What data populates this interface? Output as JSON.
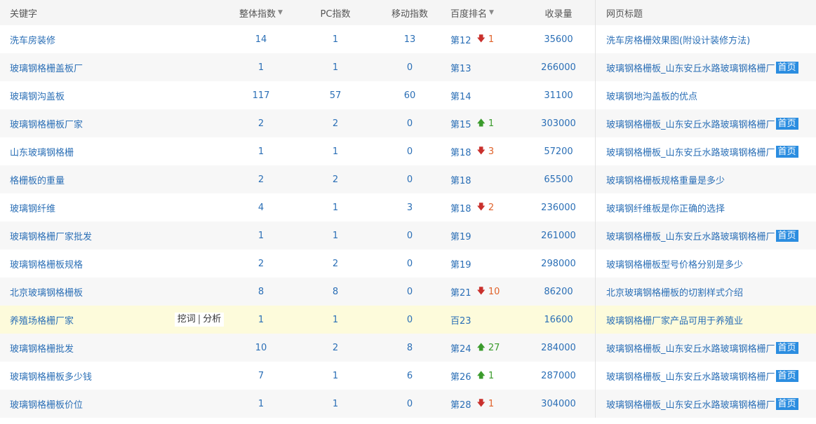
{
  "header": {
    "keyword": "关键字",
    "total_index": "整体指数",
    "pc_index": "PC指数",
    "mobile_index": "移动指数",
    "baidu_rank": "百度排名",
    "indexed_count": "收录量",
    "page_title": "网页标题"
  },
  "tools": {
    "dig": "挖词",
    "separator": "|",
    "analyze": "分析"
  },
  "rows": [
    {
      "keyword": "洗车房装修",
      "total": "14",
      "pc": "1",
      "mobile": "13",
      "rank": "第12",
      "change_dir": "down",
      "change": "1",
      "indexed": "35600",
      "title": "洗车房格栅效果图(附设计装修方法)",
      "badge": ""
    },
    {
      "keyword": "玻璃钢格栅盖板厂",
      "total": "1",
      "pc": "1",
      "mobile": "0",
      "rank": "第13",
      "change_dir": "",
      "change": "",
      "indexed": "266000",
      "title": "玻璃钢格栅板_山东安丘水路玻璃钢格栅厂",
      "badge": "首页"
    },
    {
      "keyword": "玻璃钢沟盖板",
      "total": "117",
      "pc": "57",
      "mobile": "60",
      "rank": "第14",
      "change_dir": "",
      "change": "",
      "indexed": "31100",
      "title": "玻璃钢地沟盖板的优点",
      "badge": ""
    },
    {
      "keyword": "玻璃钢格栅板厂家",
      "total": "2",
      "pc": "2",
      "mobile": "0",
      "rank": "第15",
      "change_dir": "up",
      "change": "1",
      "indexed": "303000",
      "title": "玻璃钢格栅板_山东安丘水路玻璃钢格栅厂",
      "badge": "首页"
    },
    {
      "keyword": "山东玻璃钢格栅",
      "total": "1",
      "pc": "1",
      "mobile": "0",
      "rank": "第18",
      "change_dir": "down",
      "change": "3",
      "indexed": "57200",
      "title": "玻璃钢格栅板_山东安丘水路玻璃钢格栅厂",
      "badge": "首页"
    },
    {
      "keyword": "格栅板的重量",
      "total": "2",
      "pc": "2",
      "mobile": "0",
      "rank": "第18",
      "change_dir": "",
      "change": "",
      "indexed": "65500",
      "title": "玻璃钢格栅板规格重量是多少",
      "badge": ""
    },
    {
      "keyword": "玻璃钢纤维",
      "total": "4",
      "pc": "1",
      "mobile": "3",
      "rank": "第18",
      "change_dir": "down",
      "change": "2",
      "indexed": "236000",
      "title": "玻璃钢纤维板是你正确的选择",
      "badge": ""
    },
    {
      "keyword": "玻璃钢格栅厂家批发",
      "total": "1",
      "pc": "1",
      "mobile": "0",
      "rank": "第19",
      "change_dir": "",
      "change": "",
      "indexed": "261000",
      "title": "玻璃钢格栅板_山东安丘水路玻璃钢格栅厂",
      "badge": "首页"
    },
    {
      "keyword": "玻璃钢格栅板规格",
      "total": "2",
      "pc": "2",
      "mobile": "0",
      "rank": "第19",
      "change_dir": "",
      "change": "",
      "indexed": "298000",
      "title": "玻璃钢格栅板型号价格分别是多少",
      "badge": ""
    },
    {
      "keyword": "北京玻璃钢格栅板",
      "total": "8",
      "pc": "8",
      "mobile": "0",
      "rank": "第21",
      "change_dir": "down",
      "change": "10",
      "indexed": "86200",
      "title": "北京玻璃钢格栅板的切割样式介绍",
      "badge": ""
    },
    {
      "keyword": "养殖场格栅厂家",
      "total": "1",
      "pc": "1",
      "mobile": "0",
      "rank": "百23",
      "change_dir": "",
      "change": "",
      "indexed": "16600",
      "title": "玻璃钢格栅厂家产品可用于养殖业",
      "badge": "",
      "highlight": true
    },
    {
      "keyword": "玻璃钢格栅批发",
      "total": "10",
      "pc": "2",
      "mobile": "8",
      "rank": "第24",
      "change_dir": "up",
      "change": "27",
      "indexed": "284000",
      "title": "玻璃钢格栅板_山东安丘水路玻璃钢格栅厂",
      "badge": "首页"
    },
    {
      "keyword": "玻璃钢格栅板多少钱",
      "total": "7",
      "pc": "1",
      "mobile": "6",
      "rank": "第26",
      "change_dir": "up",
      "change": "1",
      "indexed": "287000",
      "title": "玻璃钢格栅板_山东安丘水路玻璃钢格栅厂",
      "badge": "首页"
    },
    {
      "keyword": "玻璃钢格栅板价位",
      "total": "1",
      "pc": "1",
      "mobile": "0",
      "rank": "第28",
      "change_dir": "down",
      "change": "1",
      "indexed": "304000",
      "title": "玻璃钢格栅板_山东安丘水路玻璃钢格栅厂",
      "badge": "首页"
    }
  ]
}
